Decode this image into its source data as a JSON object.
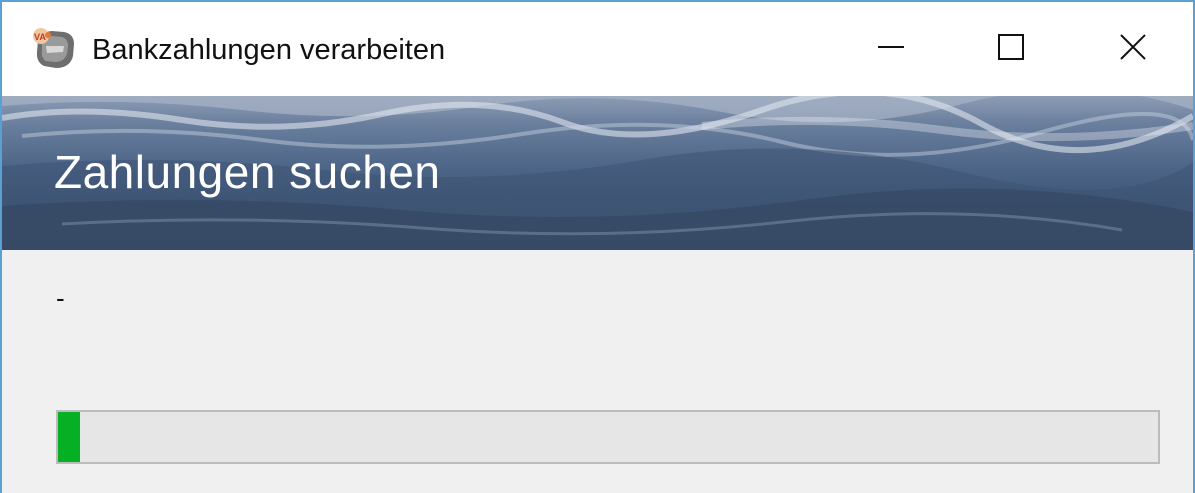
{
  "window": {
    "title": "Bankzahlungen verarbeiten",
    "icon": "app-icon",
    "controls": {
      "minimize_icon": "minimize-icon",
      "maximize_icon": "maximize-icon",
      "close_icon": "close-icon"
    }
  },
  "header": {
    "title": "Zahlungen suchen"
  },
  "status": {
    "text": "-"
  },
  "progress": {
    "value_fraction": 0.02,
    "color": "#06b025"
  },
  "colors": {
    "window_border": "#5aa0d2",
    "content_background": "#f0f0f0",
    "progress_track": "#e6e6e6"
  }
}
